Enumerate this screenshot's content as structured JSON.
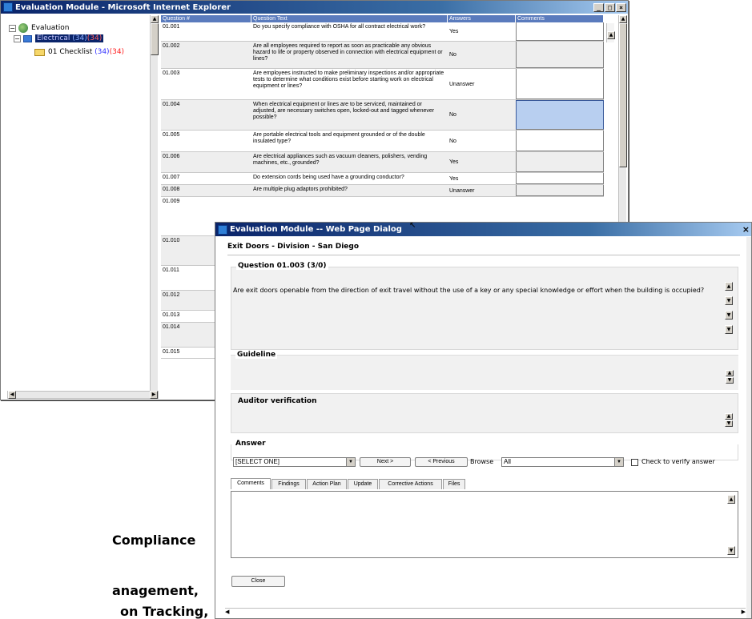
{
  "main_window": {
    "title": "Evaluation Module - Microsoft Internet Explorer",
    "buttons": {
      "minimize": "_",
      "maximize": "□",
      "close": "×"
    },
    "accent_color": "#0a246a"
  },
  "tree": {
    "root": "Evaluation",
    "node_selected": "Electrical",
    "node_selected_count1": "(34)",
    "node_selected_count2": "(34)",
    "child_label": "01 Checklist",
    "child_count1": "(34)",
    "child_count2": "(34)"
  },
  "grid": {
    "headers": [
      "Question #",
      "Question Text",
      "Answers",
      "Comments"
    ],
    "rows": [
      {
        "num": "01.001",
        "text": "Do you specify compliance with OSHA for all contract electrical work?",
        "answer": "Yes"
      },
      {
        "num": "01.002",
        "text": "Are all employees required to report as soon as practicable any obvious hazard to life or property observed in connection with electrical equipment or lines?",
        "answer": "No"
      },
      {
        "num": "01.003",
        "text": "Are employees instructed to make preliminary inspections and/or appropriate tests to determine what conditions exist before starting work on electrical equipment or lines?",
        "answer": "Unanswer"
      },
      {
        "num": "01.004",
        "text": "When electrical equipment or lines are to be serviced, maintained or adjusted, are necessary switches open, locked-out and tagged whenever possible?",
        "answer": "No"
      },
      {
        "num": "01.005",
        "text": "Are portable electrical tools and equipment grounded or of the double insulated type?",
        "answer": "No"
      },
      {
        "num": "01.006",
        "text": "Are electrical appliances such as vacuum cleaners, polishers, vending machines, etc., grounded?",
        "answer": "Yes"
      },
      {
        "num": "01.007",
        "text": "Do extension cords being used have a grounding conductor?",
        "answer": "Yes"
      },
      {
        "num": "01.008",
        "text": "Are multiple plug adaptors prohibited?",
        "answer": "Unanswer"
      },
      {
        "num": "01.009",
        "text": "",
        "answer": ""
      },
      {
        "num": "01.010",
        "text": "",
        "answer": ""
      },
      {
        "num": "01.011",
        "text": "",
        "answer": ""
      },
      {
        "num": "01.012",
        "text": "",
        "answer": ""
      },
      {
        "num": "01.013",
        "text": "",
        "answer": ""
      },
      {
        "num": "01.014",
        "text": "",
        "answer": ""
      },
      {
        "num": "01.015",
        "text": "",
        "answer": ""
      }
    ]
  },
  "dialog": {
    "title": "Evaluation Module -- Web Page Dialog",
    "header": "Exit Doors - Division - San Diego",
    "question_label": "Question 01.003 (3/0)",
    "question_text": "Are exit doors openable from the direction of exit travel without the use of a key or any special knowledge or effort when the building is occupied?",
    "guideline_label": "Guideline",
    "auditor_label": "Auditor verification",
    "answer_label": "Answer",
    "answer_select": "[SELECT ONE]",
    "next_label": "Next >",
    "previous_label": "< Previous",
    "browse_label": "Browse",
    "browse_select": "All",
    "verify_label": "Check to verify answer",
    "tabs": [
      "Comments",
      "Findings",
      "Action Plan",
      "Update",
      "Corrective Actions",
      "Files"
    ],
    "close_label": "Close"
  },
  "background_text": {
    "line1": "Compliance",
    "line2": "anagement,",
    "line3": "on Tracking,"
  }
}
